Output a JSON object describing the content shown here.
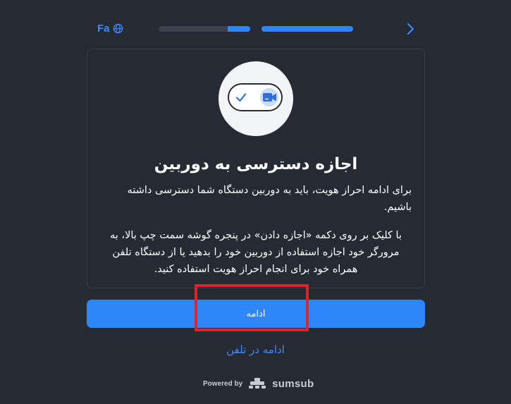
{
  "header": {
    "language_code": "Fa",
    "progress": [
      0.25,
      1.0
    ]
  },
  "card": {
    "title": "اجازه دسترسی به دوربین",
    "paragraph_1": "برای ادامه احراز هویت، باید به دوربین دستگاه شما دسترسی داشته باشیم.",
    "paragraph_2": "با کلیک بر روی دکمه «اجازه دادن» در پنجره گوشه سمت چپ بالا، به مرورگر خود اجازه استفاده از دوربین خود را بدهید یا از دستگاه تلفن همراه خود برای انجام احراز هویت استفاده کنید."
  },
  "actions": {
    "continue_label": "ادامه",
    "phone_link_label": "ادامه در تلفن"
  },
  "footer": {
    "powered_by": "Powered by",
    "brand": "sumsub"
  },
  "colors": {
    "background": "#262a33",
    "accent": "#2f86f6",
    "highlight": "#d9262c"
  },
  "icons": {
    "language": "globe-icon",
    "next": "chevron-right-icon",
    "check": "check-icon",
    "camera": "video-camera-icon",
    "brand_logo": "sumsub-logo-icon"
  }
}
